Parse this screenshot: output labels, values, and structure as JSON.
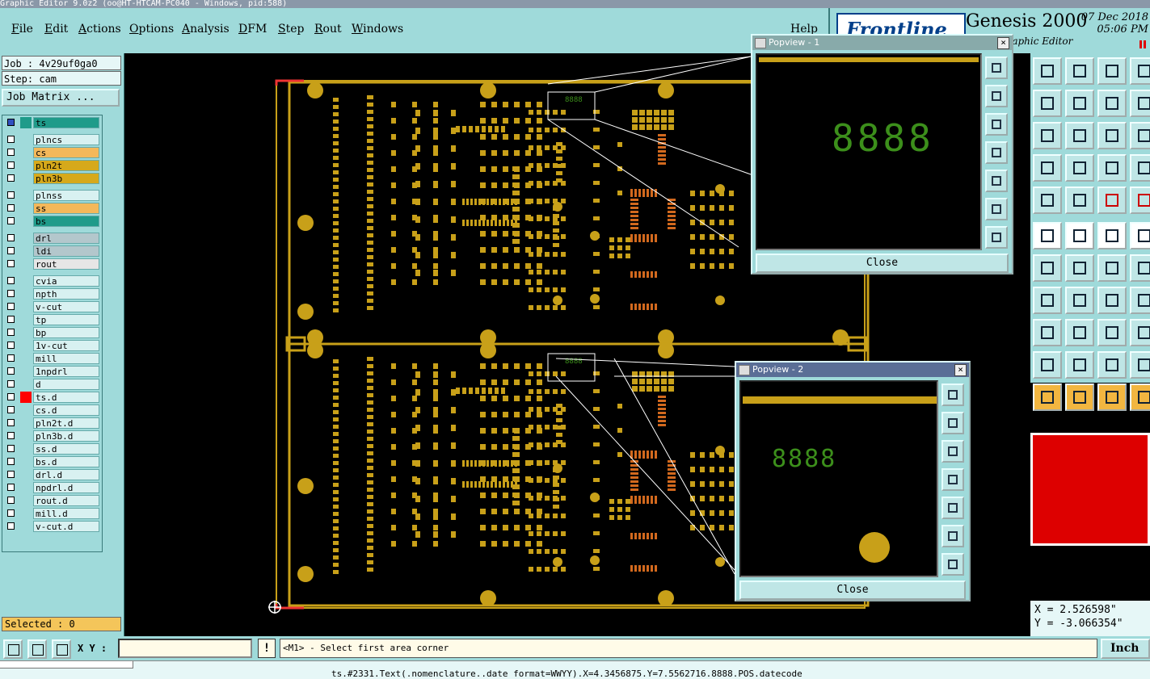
{
  "window": {
    "title": "Graphic Editor 9.0z2 (oo@HT-HTCAM-PC040 - Windows, pid:588)"
  },
  "menu": {
    "items": [
      "File",
      "Edit",
      "Actions",
      "Options",
      "Analysis",
      "DFM",
      "Step",
      "Rout",
      "Windows"
    ],
    "help": "Help"
  },
  "brand": {
    "logo_text": "Frontline",
    "product": "Genesis 2000",
    "subtitle": "Graphic Editor",
    "date": "07 Dec 2018",
    "time": "05:06 PM"
  },
  "job": {
    "job": "Job : 4v29uf0ga0",
    "step": "Step: cam",
    "matrix_button": "Job Matrix ..."
  },
  "layers": [
    {
      "name": "ts",
      "color": "#1f9b8a",
      "swatch": "#1f9b8a",
      "active": true
    },
    {
      "name": "plncs",
      "color": "#d8f1f1",
      "swatch": ""
    },
    {
      "name": "cs",
      "color": "#f4b85a",
      "swatch": ""
    },
    {
      "name": "pln2t",
      "color": "#d6a91b",
      "swatch": ""
    },
    {
      "name": "pln3b",
      "color": "#d6a91b",
      "swatch": ""
    },
    {
      "name": "plnss",
      "color": "#d8f1f1",
      "swatch": ""
    },
    {
      "name": "ss",
      "color": "#f4b85a",
      "swatch": ""
    },
    {
      "name": "bs",
      "color": "#1f9b8a",
      "swatch": ""
    },
    {
      "name": "drl",
      "color": "#b3c7cc",
      "swatch": ""
    },
    {
      "name": "ldi",
      "color": "#b3c7cc",
      "swatch": ""
    },
    {
      "name": "rout",
      "color": "#e6e6e6",
      "swatch": ""
    },
    {
      "name": "cvia",
      "color": "#d8f1f1",
      "swatch": ""
    },
    {
      "name": "npth",
      "color": "#d8f1f1",
      "swatch": ""
    },
    {
      "name": "v-cut",
      "color": "#d8f1f1",
      "swatch": ""
    },
    {
      "name": "tp",
      "color": "#d8f1f1",
      "swatch": ""
    },
    {
      "name": "bp",
      "color": "#d8f1f1",
      "swatch": ""
    },
    {
      "name": "1v-cut",
      "color": "#d8f1f1",
      "swatch": ""
    },
    {
      "name": "mill",
      "color": "#d8f1f1",
      "swatch": ""
    },
    {
      "name": "1npdrl",
      "color": "#d8f1f1",
      "swatch": ""
    },
    {
      "name": "d",
      "color": "#d8f1f1",
      "swatch": ""
    },
    {
      "name": "ts.d",
      "color": "#d8f1f1",
      "swatch": "#ff0000"
    },
    {
      "name": "cs.d",
      "color": "#d8f1f1",
      "swatch": ""
    },
    {
      "name": "pln2t.d",
      "color": "#d8f1f1",
      "swatch": ""
    },
    {
      "name": "pln3b.d",
      "color": "#d8f1f1",
      "swatch": ""
    },
    {
      "name": "ss.d",
      "color": "#d8f1f1",
      "swatch": ""
    },
    {
      "name": "bs.d",
      "color": "#d8f1f1",
      "swatch": ""
    },
    {
      "name": "drl.d",
      "color": "#d8f1f1",
      "swatch": ""
    },
    {
      "name": "npdrl.d",
      "color": "#d8f1f1",
      "swatch": ""
    },
    {
      "name": "rout.d",
      "color": "#d8f1f1",
      "swatch": ""
    },
    {
      "name": "mill.d",
      "color": "#d8f1f1",
      "swatch": ""
    },
    {
      "name": "v-cut.d",
      "color": "#d8f1f1",
      "swatch": ""
    }
  ],
  "selected": "Selected : 0",
  "board": {
    "text": "8888",
    "pad_color": "#c8a019",
    "outline_color": "#c8a019",
    "smd_color": "#d2691e"
  },
  "popview1": {
    "title": "Popview - 1",
    "text": "8888",
    "close": "Close"
  },
  "popview2": {
    "title": "Popview - 2",
    "text": "8888",
    "close": "Close"
  },
  "coords": {
    "x": "X = 2.526598\"",
    "y": "Y = -3.066354\""
  },
  "bottom": {
    "xy_label": "X Y :",
    "xy_value": "",
    "warn": "!",
    "prompt": "<M1> - Select first area corner",
    "units": "Inch"
  },
  "status": "ts.#2331.Text(.nomenclature..date format=WWYY).X=4.3456875.Y=7.5562716.8888.POS.datecode"
}
